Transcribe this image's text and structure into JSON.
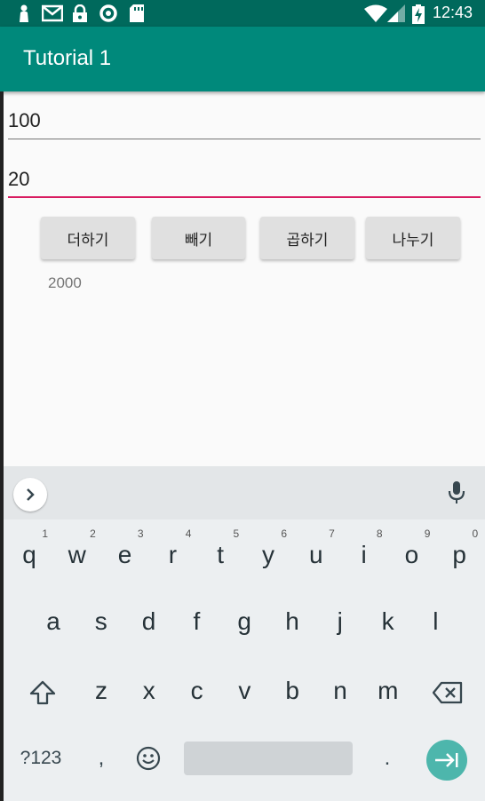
{
  "status_bar": {
    "time": "12:43",
    "left_icons": [
      "person-icon",
      "gmail-icon",
      "lock-icon",
      "circle-icon",
      "sd-card-icon"
    ],
    "right_icons": [
      "wifi-icon",
      "signal-icon",
      "battery-charging-icon"
    ],
    "color": "#00695c"
  },
  "app_bar": {
    "title": "Tutorial 1",
    "color": "#00897b"
  },
  "inputs": {
    "first_value": "100",
    "second_value": "20",
    "focus_color": "#d81b60"
  },
  "buttons": {
    "add": "더하기",
    "subtract": "빼기",
    "multiply": "곱하기",
    "divide": "나누기"
  },
  "result": "2000",
  "keyboard": {
    "row1": [
      {
        "k": "q",
        "h": "1"
      },
      {
        "k": "w",
        "h": "2"
      },
      {
        "k": "e",
        "h": "3"
      },
      {
        "k": "r",
        "h": "4"
      },
      {
        "k": "t",
        "h": "5"
      },
      {
        "k": "y",
        "h": "6"
      },
      {
        "k": "u",
        "h": "7"
      },
      {
        "k": "i",
        "h": "8"
      },
      {
        "k": "o",
        "h": "9"
      },
      {
        "k": "p",
        "h": "0"
      }
    ],
    "row2": [
      "a",
      "s",
      "d",
      "f",
      "g",
      "h",
      "j",
      "k",
      "l"
    ],
    "row3": [
      "z",
      "x",
      "c",
      "v",
      "b",
      "n",
      "m"
    ],
    "symbols_label": "?123",
    "comma": ",",
    "period": ".",
    "enter_color": "#4db6ac"
  }
}
